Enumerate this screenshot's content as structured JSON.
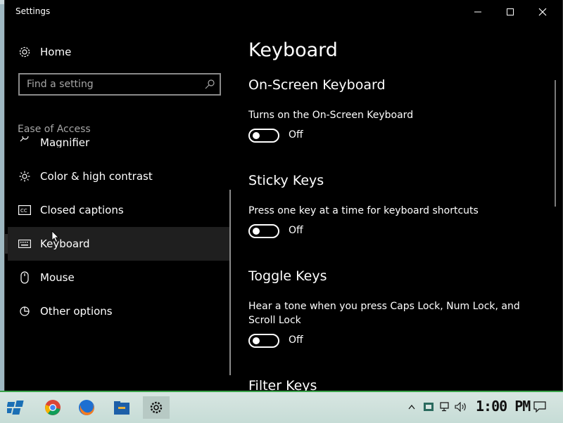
{
  "window": {
    "title": "Settings",
    "controls": {
      "minimize": "minimize",
      "maximize": "maximize",
      "close": "close"
    }
  },
  "sidebar": {
    "home_label": "Home",
    "search": {
      "placeholder": "Find a setting",
      "value": ""
    },
    "section_label": "Ease of Access",
    "items": [
      {
        "label": "Magnifier",
        "icon": "magnifier-icon"
      },
      {
        "label": "Color & high contrast",
        "icon": "brightness-icon"
      },
      {
        "label": "Closed captions",
        "icon": "cc-icon"
      },
      {
        "label": "Keyboard",
        "icon": "keyboard-icon",
        "selected": true
      },
      {
        "label": "Mouse",
        "icon": "mouse-icon"
      },
      {
        "label": "Other options",
        "icon": "other-options-icon"
      }
    ]
  },
  "main": {
    "page_title": "Keyboard",
    "groups": [
      {
        "title": "On-Screen Keyboard",
        "description": "Turns on the On-Screen Keyboard",
        "state": "Off"
      },
      {
        "title": "Sticky Keys",
        "description": "Press one key at a time for keyboard shortcuts",
        "state": "Off"
      },
      {
        "title": "Toggle Keys",
        "description": "Hear a tone when you press Caps Lock, Num Lock, and Scroll Lock",
        "state": "Off"
      },
      {
        "title": "Filter Keys"
      }
    ]
  },
  "taskbar": {
    "clock": "1:00 PM",
    "apps": [
      "start-icon",
      "chrome-icon",
      "firefox-icon",
      "file-explorer-icon",
      "settings-icon"
    ],
    "tray": [
      "chevron-up-icon",
      "app-tray-icon",
      "network-icon",
      "volume-icon",
      "notification-icon"
    ]
  },
  "colors": {
    "window_bg": "#000000",
    "text": "#ffffff",
    "muted_text": "#a6a6a6",
    "selected_bg": "#1f1f1f",
    "taskbar_bg": "#c6dcd6"
  }
}
